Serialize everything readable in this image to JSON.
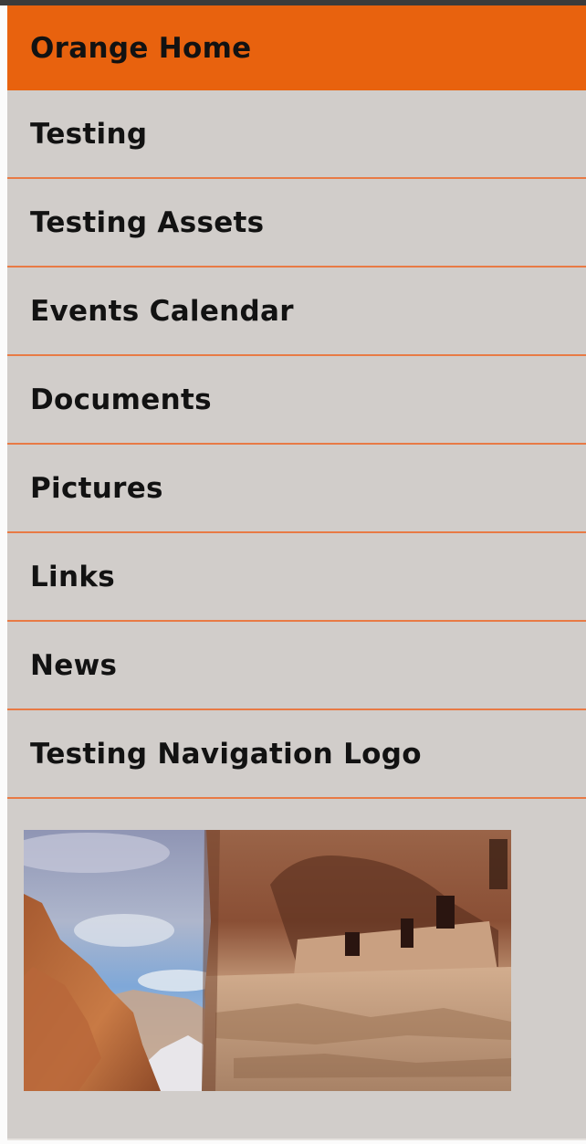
{
  "nav": {
    "items": [
      {
        "label": "Orange Home",
        "active": true
      },
      {
        "label": "Testing",
        "active": false
      },
      {
        "label": "Testing Assets",
        "active": false
      },
      {
        "label": "Events Calendar",
        "active": false
      },
      {
        "label": "Documents",
        "active": false
      },
      {
        "label": "Pictures",
        "active": false
      },
      {
        "label": "Links",
        "active": false
      },
      {
        "label": "News",
        "active": false
      },
      {
        "label": "Testing Navigation Logo",
        "active": false
      }
    ]
  },
  "colors": {
    "accent": "#e8620e",
    "separator": "#e87a45",
    "panel_bg": "#d1cdca",
    "text": "#121212"
  },
  "logo": {
    "icon": "canyon-cliff-dwelling-image"
  }
}
